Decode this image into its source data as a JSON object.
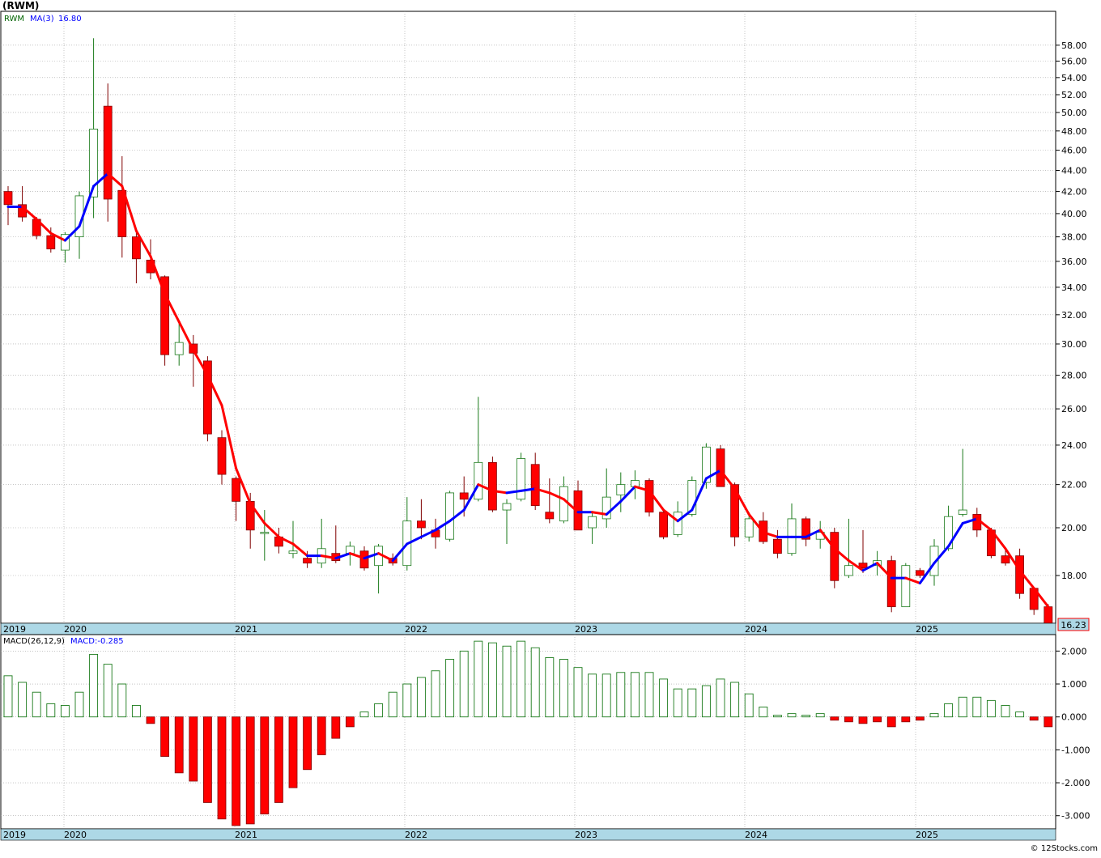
{
  "header": {
    "symbol": "(RWM)"
  },
  "price_legend": {
    "ticker": "RWM",
    "ma_label": "MA(3)",
    "ma_value": "16.80"
  },
  "last_price": "16.23",
  "macd_legend": {
    "label": "MACD(26,12,9)",
    "value_label": "MACD:-0.285"
  },
  "footer": "© 12Stocks.com",
  "colors": {
    "up": "#1a7a1a",
    "down": "#ff0000",
    "ma_up": "#0000ff",
    "ma_down": "#ff0000",
    "axis_band": "#add8e6",
    "grid": "#a0a0a0"
  },
  "chart_data": [
    {
      "type": "candlestick",
      "title": "(RWM)",
      "interval": "monthly",
      "x_labels": [
        "2019",
        "2020",
        "2021",
        "2022",
        "2023",
        "2024",
        "2025"
      ],
      "y_ticks": [
        "18.00",
        "20.00",
        "22.00",
        "24.00",
        "26.00",
        "28.00",
        "30.00",
        "32.00",
        "34.00",
        "36.00",
        "38.00",
        "40.00",
        "42.00",
        "44.00",
        "46.00",
        "48.00",
        "50.00",
        "52.00",
        "54.00",
        "56.00",
        "58.00"
      ],
      "y_scale": "log",
      "ylim": [
        16.2,
        62.5
      ],
      "grid": true,
      "candles": [
        {
          "o": 42.0,
          "h": 42.5,
          "l": 39.0,
          "c": 40.8
        },
        {
          "o": 40.8,
          "h": 42.5,
          "l": 39.3,
          "c": 39.7
        },
        {
          "o": 39.5,
          "h": 39.7,
          "l": 37.8,
          "c": 38.1
        },
        {
          "o": 38.1,
          "h": 38.8,
          "l": 36.7,
          "c": 37.0
        },
        {
          "o": 36.9,
          "h": 38.4,
          "l": 35.9,
          "c": 38.2
        },
        {
          "o": 38.0,
          "h": 42.0,
          "l": 36.2,
          "c": 41.6
        },
        {
          "o": 41.5,
          "h": 58.9,
          "l": 39.6,
          "c": 48.2
        },
        {
          "o": 50.7,
          "h": 53.3,
          "l": 39.3,
          "c": 41.3
        },
        {
          "o": 42.1,
          "h": 45.4,
          "l": 36.3,
          "c": 38.0
        },
        {
          "o": 38.0,
          "h": 38.6,
          "l": 34.3,
          "c": 36.2
        },
        {
          "o": 36.1,
          "h": 37.8,
          "l": 34.6,
          "c": 35.1
        },
        {
          "o": 34.8,
          "h": 34.9,
          "l": 28.6,
          "c": 29.3
        },
        {
          "o": 29.3,
          "h": 31.4,
          "l": 28.6,
          "c": 30.1
        },
        {
          "o": 30.0,
          "h": 30.6,
          "l": 27.3,
          "c": 29.4
        },
        {
          "o": 28.9,
          "h": 29.2,
          "l": 24.2,
          "c": 24.6
        },
        {
          "o": 24.4,
          "h": 24.8,
          "l": 22.0,
          "c": 22.5
        },
        {
          "o": 22.3,
          "h": 22.4,
          "l": 20.3,
          "c": 21.2
        },
        {
          "o": 21.2,
          "h": 21.6,
          "l": 19.1,
          "c": 19.9
        },
        {
          "o": 19.8,
          "h": 20.8,
          "l": 18.6,
          "c": 19.8
        },
        {
          "o": 19.6,
          "h": 20.0,
          "l": 18.9,
          "c": 19.2
        },
        {
          "o": 18.9,
          "h": 20.3,
          "l": 18.7,
          "c": 19.0
        },
        {
          "o": 18.7,
          "h": 19.0,
          "l": 18.3,
          "c": 18.5
        },
        {
          "o": 18.5,
          "h": 20.4,
          "l": 18.3,
          "c": 19.1
        },
        {
          "o": 18.9,
          "h": 20.1,
          "l": 18.5,
          "c": 18.6
        },
        {
          "o": 18.9,
          "h": 19.4,
          "l": 18.4,
          "c": 19.2
        },
        {
          "o": 19.0,
          "h": 19.2,
          "l": 18.2,
          "c": 18.3
        },
        {
          "o": 18.4,
          "h": 19.3,
          "l": 17.3,
          "c": 19.2
        },
        {
          "o": 18.7,
          "h": 18.9,
          "l": 18.4,
          "c": 18.5
        },
        {
          "o": 18.4,
          "h": 21.4,
          "l": 18.2,
          "c": 20.3
        },
        {
          "o": 20.3,
          "h": 21.3,
          "l": 19.5,
          "c": 20.0
        },
        {
          "o": 19.9,
          "h": 20.4,
          "l": 19.1,
          "c": 19.6
        },
        {
          "o": 19.5,
          "h": 21.7,
          "l": 19.4,
          "c": 21.6
        },
        {
          "o": 21.6,
          "h": 22.4,
          "l": 20.5,
          "c": 21.3
        },
        {
          "o": 21.3,
          "h": 26.7,
          "l": 21.2,
          "c": 23.1
        },
        {
          "o": 23.1,
          "h": 23.4,
          "l": 20.7,
          "c": 20.8
        },
        {
          "o": 20.8,
          "h": 21.3,
          "l": 19.3,
          "c": 21.1
        },
        {
          "o": 21.3,
          "h": 23.6,
          "l": 21.2,
          "c": 23.3
        },
        {
          "o": 23.0,
          "h": 23.6,
          "l": 20.8,
          "c": 21.0
        },
        {
          "o": 20.7,
          "h": 22.3,
          "l": 20.2,
          "c": 20.4
        },
        {
          "o": 20.3,
          "h": 22.4,
          "l": 20.2,
          "c": 21.9
        },
        {
          "o": 21.7,
          "h": 22.2,
          "l": 19.9,
          "c": 19.9
        },
        {
          "o": 20.0,
          "h": 20.7,
          "l": 19.3,
          "c": 20.5
        },
        {
          "o": 20.4,
          "h": 22.8,
          "l": 20.0,
          "c": 21.4
        },
        {
          "o": 21.5,
          "h": 22.6,
          "l": 20.7,
          "c": 22.0
        },
        {
          "o": 21.9,
          "h": 22.7,
          "l": 21.3,
          "c": 22.2
        },
        {
          "o": 22.2,
          "h": 22.3,
          "l": 20.5,
          "c": 20.7
        },
        {
          "o": 20.7,
          "h": 20.8,
          "l": 19.5,
          "c": 19.6
        },
        {
          "o": 19.7,
          "h": 21.2,
          "l": 19.6,
          "c": 20.7
        },
        {
          "o": 20.6,
          "h": 22.4,
          "l": 20.5,
          "c": 22.2
        },
        {
          "o": 22.1,
          "h": 24.1,
          "l": 21.8,
          "c": 23.9
        },
        {
          "o": 23.8,
          "h": 24.0,
          "l": 21.9,
          "c": 21.9
        },
        {
          "o": 22.0,
          "h": 22.1,
          "l": 19.2,
          "c": 19.6
        },
        {
          "o": 19.6,
          "h": 20.7,
          "l": 19.4,
          "c": 20.4
        },
        {
          "o": 20.3,
          "h": 20.7,
          "l": 19.3,
          "c": 19.4
        },
        {
          "o": 19.5,
          "h": 19.9,
          "l": 18.7,
          "c": 18.9
        },
        {
          "o": 18.9,
          "h": 21.1,
          "l": 18.8,
          "c": 20.4
        },
        {
          "o": 20.4,
          "h": 20.5,
          "l": 19.2,
          "c": 19.5
        },
        {
          "o": 19.5,
          "h": 20.3,
          "l": 19.1,
          "c": 19.8
        },
        {
          "o": 19.8,
          "h": 20.0,
          "l": 17.5,
          "c": 17.8
        },
        {
          "o": 18.0,
          "h": 20.4,
          "l": 17.9,
          "c": 18.4
        },
        {
          "o": 18.5,
          "h": 19.9,
          "l": 18.1,
          "c": 18.3
        },
        {
          "o": 18.4,
          "h": 19.0,
          "l": 18.0,
          "c": 18.6
        },
        {
          "o": 18.6,
          "h": 18.8,
          "l": 16.6,
          "c": 16.8
        },
        {
          "o": 16.8,
          "h": 18.5,
          "l": 16.8,
          "c": 18.4
        },
        {
          "o": 18.2,
          "h": 18.3,
          "l": 17.9,
          "c": 18.0
        },
        {
          "o": 18.0,
          "h": 19.5,
          "l": 17.6,
          "c": 19.2
        },
        {
          "o": 19.1,
          "h": 21.0,
          "l": 19.0,
          "c": 20.5
        },
        {
          "o": 20.6,
          "h": 23.8,
          "l": 20.5,
          "c": 20.8
        },
        {
          "o": 20.6,
          "h": 20.9,
          "l": 19.6,
          "c": 19.9
        },
        {
          "o": 19.9,
          "h": 20.0,
          "l": 18.7,
          "c": 18.8
        },
        {
          "o": 18.8,
          "h": 19.1,
          "l": 18.4,
          "c": 18.5
        },
        {
          "o": 18.8,
          "h": 19.1,
          "l": 17.1,
          "c": 17.3
        },
        {
          "o": 17.5,
          "h": 17.5,
          "l": 16.5,
          "c": 16.7
        },
        {
          "o": 16.8,
          "h": 16.9,
          "l": 16.1,
          "c": 16.2
        }
      ],
      "ma3": [
        40.6,
        40.6,
        39.5,
        38.3,
        37.7,
        38.9,
        42.5,
        43.7,
        42.5,
        38.5,
        36.4,
        33.5,
        31.5,
        29.6,
        28.0,
        26.2,
        22.8,
        21.1,
        20.2,
        19.6,
        19.3,
        18.8,
        18.8,
        18.7,
        18.9,
        18.7,
        18.9,
        18.6,
        19.3,
        19.6,
        19.9,
        20.3,
        20.8,
        22.0,
        21.7,
        21.6,
        21.7,
        21.8,
        21.6,
        21.3,
        20.7,
        20.7,
        20.6,
        21.2,
        21.9,
        21.7,
        20.8,
        20.3,
        20.8,
        22.3,
        22.7,
        21.8,
        20.6,
        19.8,
        19.6,
        19.6,
        19.6,
        19.9,
        19.1,
        18.6,
        18.2,
        18.5,
        17.9,
        17.9,
        17.7,
        18.5,
        19.2,
        20.2,
        20.4,
        19.9,
        19.1,
        18.2,
        17.5,
        16.8
      ]
    },
    {
      "type": "bar",
      "title": "MACD(26,12,9)",
      "x_labels": [
        "2019",
        "2020",
        "2021",
        "2022",
        "2023",
        "2024",
        "2025"
      ],
      "y_ticks": [
        "2.000",
        "1.000",
        "0.000",
        "-1.000",
        "-2.000",
        "-3.000"
      ],
      "ylim": [
        -3.4,
        2.5
      ],
      "values": [
        1.25,
        1.05,
        0.75,
        0.4,
        0.35,
        0.75,
        1.9,
        1.6,
        1.0,
        0.35,
        -0.2,
        -1.2,
        -1.7,
        -1.95,
        -2.6,
        -3.1,
        -3.3,
        -3.25,
        -2.95,
        -2.6,
        -2.15,
        -1.6,
        -1.15,
        -0.65,
        -0.3,
        0.15,
        0.4,
        0.75,
        1.0,
        1.2,
        1.4,
        1.75,
        2.0,
        2.3,
        2.25,
        2.15,
        2.3,
        2.1,
        1.8,
        1.75,
        1.5,
        1.3,
        1.3,
        1.35,
        1.35,
        1.35,
        1.15,
        0.85,
        0.85,
        0.95,
        1.15,
        1.05,
        0.7,
        0.3,
        0.05,
        0.1,
        0.05,
        0.1,
        -0.1,
        -0.15,
        -0.2,
        -0.15,
        -0.3,
        -0.15,
        -0.1,
        0.1,
        0.4,
        0.6,
        0.6,
        0.5,
        0.35,
        0.15,
        -0.1,
        -0.3
      ]
    }
  ]
}
